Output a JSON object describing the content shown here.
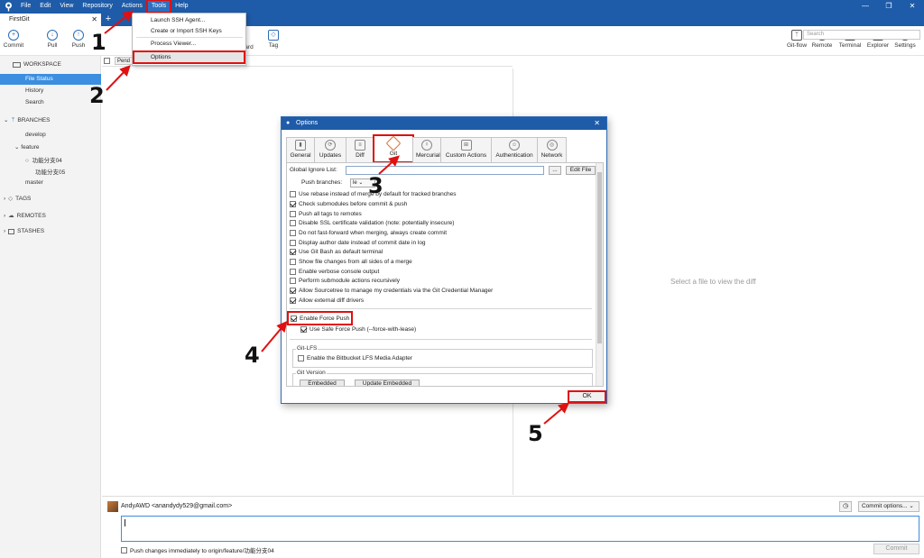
{
  "menubar": {
    "items": [
      "File",
      "Edit",
      "View",
      "Repository",
      "Actions",
      "Tools",
      "Help"
    ],
    "active": "Tools",
    "window_controls": [
      "—",
      "❐",
      "✕"
    ]
  },
  "tabs": {
    "repo_tab": "FirstGit",
    "close": "✕",
    "add": "+"
  },
  "toolbar": {
    "commit": "Commit",
    "pull": "Pull",
    "push": "Push",
    "fetch_partial": "ch",
    "forward_partial": "ard",
    "tag": "Tag",
    "gitflow": "Git-flow",
    "remote": "Remote",
    "terminal": "Terminal",
    "explorer": "Explorer",
    "settings": "Settings",
    "remote_badge": "!"
  },
  "search": {
    "placeholder": "Search"
  },
  "sidebar": {
    "workspace": "WORKSPACE",
    "workspace_items": [
      "File Status",
      "History",
      "Search"
    ],
    "branches": "BRANCHES",
    "branch_items": [
      "develop",
      "feature",
      "功能分支04",
      "功能分支05",
      "master"
    ],
    "tags": "TAGS",
    "remotes": "REMOTES",
    "stashes": "STASHES"
  },
  "file_list": {
    "pending": "Pend"
  },
  "diff": {
    "empty_message": "Select a file to view the diff"
  },
  "tools_menu": {
    "items": [
      "Launch SSH Agent...",
      "Create or Import SSH Keys",
      "Process Viewer...",
      "Options"
    ]
  },
  "dialog": {
    "title": "Options",
    "close": "✕",
    "tabs": [
      "General",
      "Updates",
      "Diff",
      "Git",
      "Mercurial",
      "Custom Actions",
      "Authentication",
      "Network"
    ],
    "selected_tab": "Git",
    "global_ignore_label": "Global Ignore List:",
    "browse": "...",
    "edit_file": "Edit File",
    "push_branches_label": "Push branches:",
    "push_branches_value": "le",
    "options": [
      {
        "label": "Use rebase instead of merge by default for tracked branches",
        "checked": false
      },
      {
        "label": "Check submodules before commit & push",
        "checked": true
      },
      {
        "label": "Push all tags to remotes",
        "checked": false
      },
      {
        "label": "Disable SSL certificate validation (note: potentially insecure)",
        "checked": false
      },
      {
        "label": "Do not fast-forward when merging, always create commit",
        "checked": false
      },
      {
        "label": "Display author date instead of commit date in log",
        "checked": false
      },
      {
        "label": "Use Git Bash as default terminal",
        "checked": true
      },
      {
        "label": "Show file changes from all sides of a merge",
        "checked": false
      },
      {
        "label": "Enable verbose console output",
        "checked": false
      },
      {
        "label": "Perform submodule actions recursively",
        "checked": false
      },
      {
        "label": "Allow Sourcetree to manage my credentials via the Git Credential Manager",
        "checked": true
      },
      {
        "label": "Allow external diff drivers",
        "checked": true
      }
    ],
    "force_push": {
      "label": "Enable Force Push",
      "checked": true
    },
    "safe_force_push": {
      "label": "Use Safe Force Push (--force-with-lease)",
      "checked": true
    },
    "git_lfs": {
      "legend": "Git-LFS",
      "label": "Enable the Bitbucket LFS Media Adapter",
      "checked": false
    },
    "git_version": {
      "legend": "Git Version",
      "embedded": "Embedded",
      "update_embedded": "Update Embedded"
    },
    "ok": "OK"
  },
  "commit_area": {
    "author": "AndyAWD <anandydy529@gmail.com>",
    "commit_options": "Commit options...",
    "push_label": "Push changes immediately to origin/feature/功能分支04",
    "commit_button": "Commit"
  },
  "annotations": {
    "steps": [
      "1",
      "2",
      "3",
      "4",
      "5"
    ]
  },
  "colors": {
    "titlebar": "#1e5ba8",
    "selection": "#3b8ee0",
    "highlight": "#e01010"
  }
}
